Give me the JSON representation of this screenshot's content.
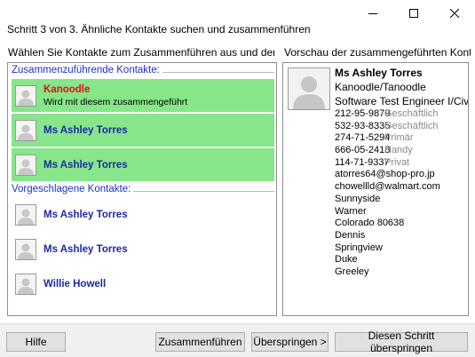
{
  "window": {
    "title": "Schritt 3 von 3. Ähnliche Kontakte suchen und zusammenführen"
  },
  "left": {
    "caption": "Wählen Sie Kontakte zum Zusammenführen aus und den Quellkontakt",
    "merging_group_label": "Zusammenzuführende Kontakte:",
    "merging": [
      {
        "name": "Kanoodle",
        "sub": "Wird mit diesem zusammengeführt"
      },
      {
        "name": "Ms Ashley Torres"
      },
      {
        "name": "Ms Ashley Torres"
      }
    ],
    "suggested_group_label": "Vorgeschlagene Kontakte:",
    "suggested": [
      {
        "name": "Ms Ashley Torres"
      },
      {
        "name": "Ms Ashley Torres"
      },
      {
        "name": "Willie Howell"
      }
    ]
  },
  "preview": {
    "caption": "Vorschau der zusammengeführten Kontakte",
    "name": "Ms Ashley Torres",
    "company": "Kanoodle/Tanoodle",
    "job_title": "Software Test Engineer I/Civil ...",
    "phones": [
      {
        "number": "212-95-9879",
        "type": "Geschäftlich"
      },
      {
        "number": "532-93-8335",
        "type": "Geschäftlich"
      },
      {
        "number": "274-71-5294",
        "type": "Primär"
      },
      {
        "number": "666-05-2418",
        "type": "Handy"
      },
      {
        "number": "114-71-9337",
        "type": "Privat"
      }
    ],
    "emails": [
      "atorres64@shop-pro.jp",
      "chowellld@walmart.com"
    ],
    "address": [
      "Sunnyside",
      "Warner",
      "Colorado  80638",
      "Dennis",
      "Springview",
      "Duke",
      "Greeley"
    ]
  },
  "buttons": {
    "help": "Hilfe",
    "merge": "Zusammenführen",
    "skip": "Überspringen >",
    "skip_step": "Diesen Schritt überspringen"
  },
  "colors": {
    "selected_bg": "#87e58a",
    "name_blue": "#1b2aa0",
    "name_red": "#e01010",
    "group_label": "#1a32c8"
  },
  "icons": {
    "minimize": "minimize-icon",
    "maximize": "maximize-icon",
    "close": "close-icon",
    "avatar": "person-silhouette-icon"
  }
}
